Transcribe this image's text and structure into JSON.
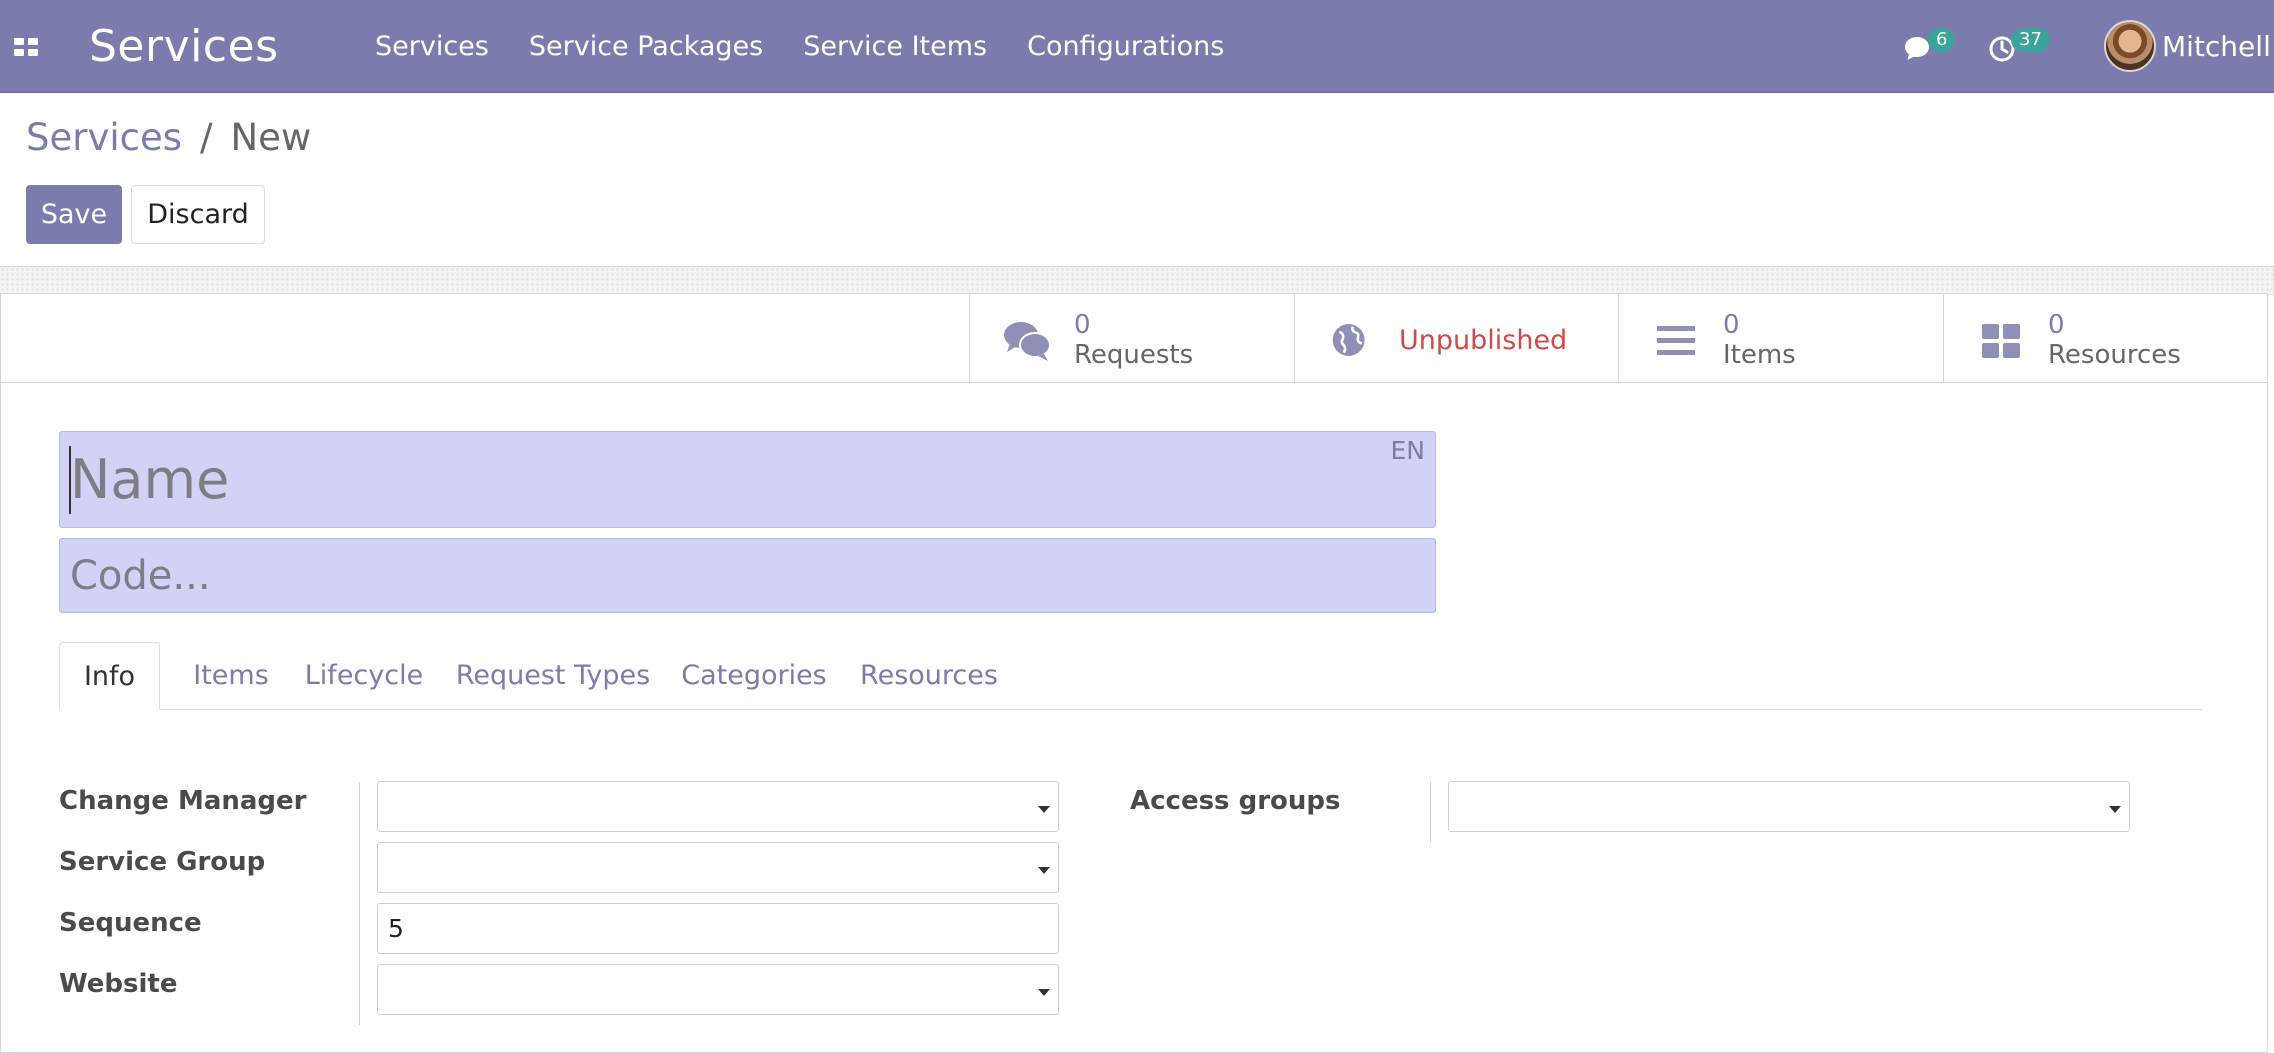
{
  "navbar": {
    "app_title": "Services",
    "menu": [
      "Services",
      "Service Packages",
      "Service Items",
      "Configurations"
    ],
    "messages_count": "6",
    "activities_count": "37",
    "user_name": "Mitchell"
  },
  "breadcrumb": {
    "parent": "Services",
    "separator": "/",
    "current": "New"
  },
  "buttons": {
    "save": "Save",
    "discard": "Discard"
  },
  "stat_buttons": {
    "requests": {
      "value": "0",
      "label": "Requests"
    },
    "website": {
      "label": "Unpublished"
    },
    "items": {
      "value": "0",
      "label": "Items"
    },
    "resources": {
      "value": "0",
      "label": "Resources"
    }
  },
  "fields": {
    "name_placeholder": "Name",
    "name_lang": "EN",
    "code_placeholder": "Code...",
    "change_manager_label": "Change Manager",
    "service_group_label": "Service Group",
    "sequence_label": "Sequence",
    "sequence_value": "5",
    "website_label": "Website",
    "access_groups_label": "Access groups"
  },
  "tabs": [
    "Info",
    "Items",
    "Lifecycle",
    "Request Types",
    "Categories",
    "Resources"
  ],
  "colors": {
    "brand": "#7c7bad",
    "badge": "#3aa39a",
    "danger": "#cf4b4b",
    "required_field": "#d2d2f6"
  }
}
